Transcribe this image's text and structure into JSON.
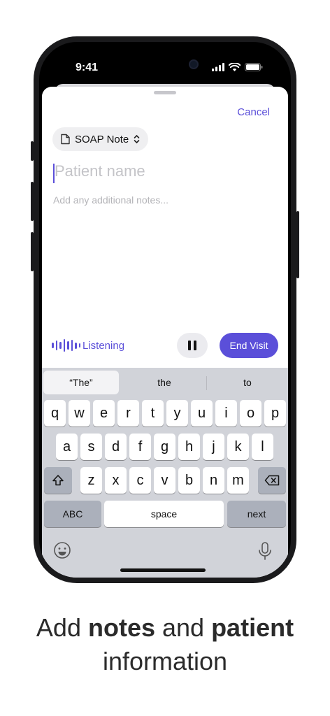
{
  "status_bar": {
    "time": "9:41"
  },
  "sheet": {
    "cancel_label": "Cancel",
    "template_label": "SOAP Note",
    "patient_placeholder": "Patient name",
    "notes_placeholder": "Add any additional notes..."
  },
  "recording": {
    "status_label": "Listening",
    "end_visit_label": "End Visit"
  },
  "keyboard": {
    "suggestions": [
      "“The”",
      "the",
      "to"
    ],
    "row1": [
      "q",
      "w",
      "e",
      "r",
      "t",
      "y",
      "u",
      "i",
      "o",
      "p"
    ],
    "row2": [
      "a",
      "s",
      "d",
      "f",
      "g",
      "h",
      "j",
      "k",
      "l"
    ],
    "row3": [
      "z",
      "x",
      "c",
      "v",
      "b",
      "n",
      "m"
    ],
    "abc_label": "ABC",
    "space_label": "space",
    "next_label": "next"
  },
  "caption": {
    "part1": "Add ",
    "bold1": "notes",
    "part2": " and ",
    "bold2": "patient",
    "line2": "information"
  },
  "colors": {
    "accent": "#5b4fd9",
    "keyboard_bg": "#d1d3d9"
  }
}
